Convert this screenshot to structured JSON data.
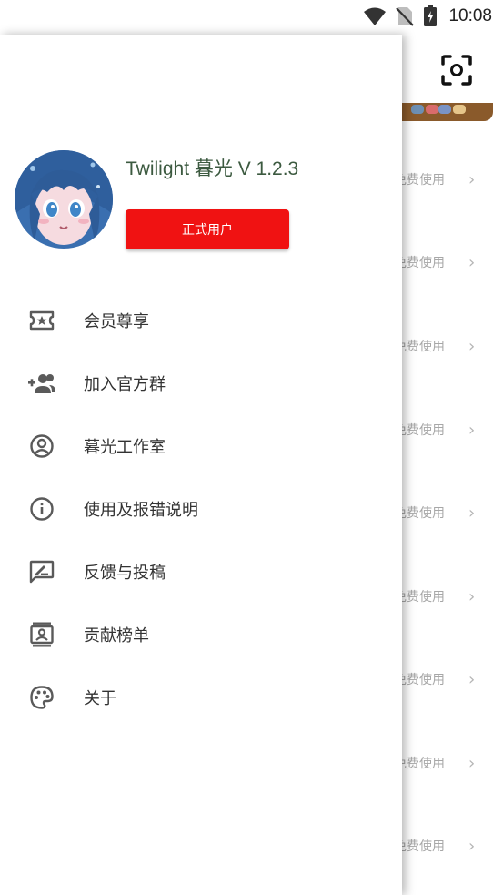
{
  "status_bar": {
    "time": "10:08"
  },
  "background": {
    "rows": [
      {
        "label": "免费使用"
      },
      {
        "label": "免费使用"
      },
      {
        "label": "免费使用"
      },
      {
        "label": "免费使用"
      },
      {
        "label": "免费使用"
      },
      {
        "label": "免费使用"
      },
      {
        "label": "免费使用"
      },
      {
        "label": "免费使用"
      },
      {
        "label": "免费使用"
      }
    ]
  },
  "drawer": {
    "title": "Twilight 暮光 V 1.2.3",
    "user_button_label": "正式用户",
    "items": [
      {
        "label": "会员尊享",
        "icon": "ticket-star-icon"
      },
      {
        "label": "加入官方群",
        "icon": "group-add-icon"
      },
      {
        "label": "暮光工作室",
        "icon": "account-circle-icon"
      },
      {
        "label": "使用及报错说明",
        "icon": "info-icon"
      },
      {
        "label": "反馈与投稿",
        "icon": "feedback-edit-icon"
      },
      {
        "label": "贡献榜单",
        "icon": "contacts-icon"
      },
      {
        "label": "关于",
        "icon": "palette-icon"
      }
    ]
  },
  "colors": {
    "accent_red": "#f01212",
    "title_green": "#3c5a40",
    "icon_gray": "#5a5a5a"
  }
}
